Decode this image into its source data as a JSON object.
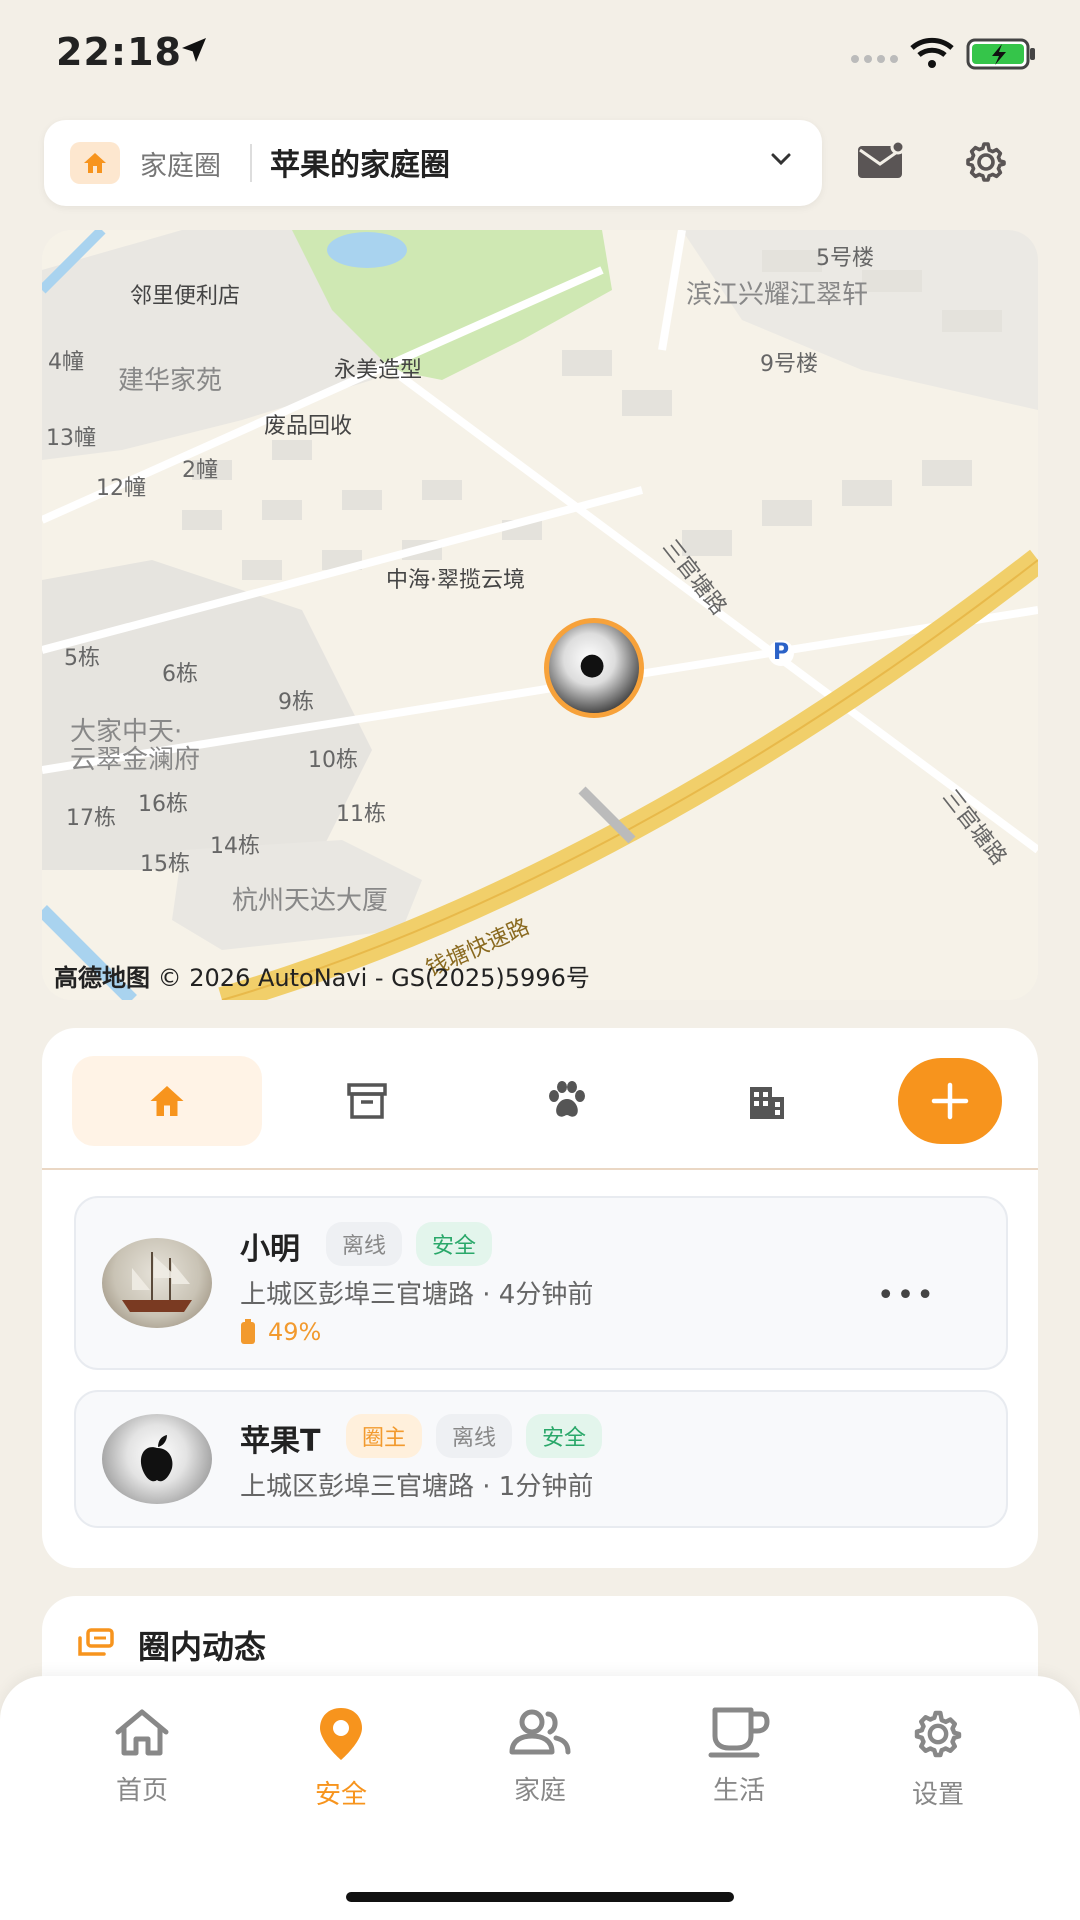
{
  "status_bar": {
    "time": "22:18"
  },
  "top_bar": {
    "circle_label": "家庭圈",
    "circle_name": "苹果的家庭圈"
  },
  "map": {
    "labels": {
      "store": "邻里便利店",
      "estate_a": "建华家苑",
      "salon": "永美造型",
      "recycle": "废品回收",
      "b4": "4幢",
      "b13": "13幢",
      "b2": "2幢",
      "b12": "12幢",
      "estate_b": "滨江兴耀江翠轩",
      "b5lou": "5号楼",
      "b9lou": "9号楼",
      "estate_c": "中海·翠揽云境",
      "road_sgt": "三官塘路",
      "road_sgt2": "三官塘路",
      "estate_d": "大家中天·\n云翠金澜府",
      "d5": "5栋",
      "d6": "6栋",
      "d9": "9栋",
      "d10": "10栋",
      "d11": "11栋",
      "d14": "14栋",
      "d15": "15栋",
      "d16": "16栋",
      "d17": "17栋",
      "tower": "杭州天达大厦",
      "expressway": "钱塘快速路",
      "parking": "P"
    },
    "logo": "高德地图",
    "copyright": "© 2026 AutoNavi - GS(2025)5996号"
  },
  "members": [
    {
      "name": "小明",
      "tags": [
        {
          "text": "离线",
          "style": "gray"
        },
        {
          "text": "安全",
          "style": "green"
        }
      ],
      "address": "上城区彭埠三官塘路 · 4分钟前",
      "battery": "49%"
    },
    {
      "name": "苹果T",
      "tags": [
        {
          "text": "圈主",
          "style": "orange"
        },
        {
          "text": "离线",
          "style": "gray"
        },
        {
          "text": "安全",
          "style": "green"
        }
      ],
      "address": "上城区彭埠三官塘路 · 1分钟前"
    }
  ],
  "feed": {
    "title": "圈内动态"
  },
  "nav": [
    {
      "label": "首页"
    },
    {
      "label": "安全"
    },
    {
      "label": "家庭"
    },
    {
      "label": "生活"
    },
    {
      "label": "设置"
    }
  ],
  "colors": {
    "accent": "#f7941d",
    "safe": "#2aa86a",
    "background": "#f3efe7"
  }
}
